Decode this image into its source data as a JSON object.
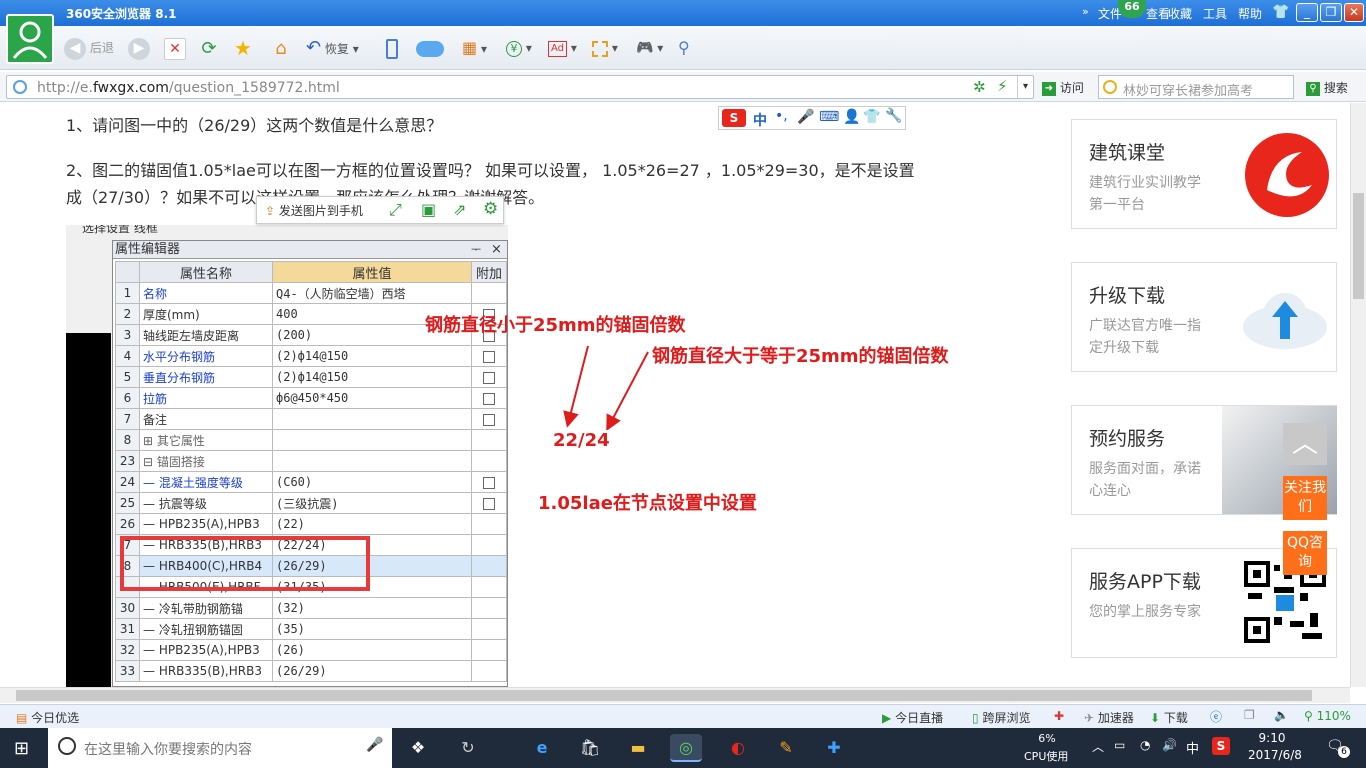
{
  "browser": {
    "title": "360安全浏览器 8.1",
    "menu": [
      "文件",
      "查看",
      "收藏",
      "工具",
      "帮助"
    ],
    "badge": "66",
    "toolbar": {
      "back_label": "后退",
      "restore_label": "恢复"
    },
    "address": {
      "url_prefix": "http://e.",
      "url_domain": "fwxgx.com",
      "url_path": "/question_1589772.html",
      "go_label": "访问"
    },
    "search": {
      "placeholder": "林妙可穿长裙参加高考",
      "button_label": "搜索"
    }
  },
  "question": {
    "line1": "1、请问图一中的（26/29）这两个数值是什么意思？",
    "line2a": "2、图二的锚固值1.05*lae可以在图一方框的位置设置吗？ 如果可以设置， 1.05*26=27 ，1.05*29=30，是不是设置",
    "line2b": "成（27/30）？如果不可以这样设置，那应该怎么处理？谢谢解答。"
  },
  "image_toolbar": {
    "send_label": "发送图片到手机"
  },
  "screenshot": {
    "top_strip": "选择设置   线框",
    "panel_title": "属性编辑器",
    "panel_pin": "ᅮ",
    "panel_close": "×",
    "headers": [
      "",
      "属性名称",
      "属性值",
      "附加"
    ],
    "rows": [
      {
        "n": "1",
        "name": "名称",
        "value": "Q4-（人防临空墙）西塔",
        "blue": true,
        "check": false
      },
      {
        "n": "2",
        "name": "厚度(mm)",
        "value": "400",
        "blue": false,
        "check": true
      },
      {
        "n": "3",
        "name": "轴线距左墙皮距离",
        "value": "(200)",
        "blue": false,
        "check": true
      },
      {
        "n": "4",
        "name": "水平分布钢筋",
        "value": "(2)ф14@150",
        "blue": true,
        "check": true
      },
      {
        "n": "5",
        "name": "垂直分布钢筋",
        "value": "(2)ф14@150",
        "blue": true,
        "check": true
      },
      {
        "n": "6",
        "name": "拉筋",
        "value": "ф6@450*450",
        "blue": true,
        "check": true
      },
      {
        "n": "7",
        "name": "备注",
        "value": "",
        "blue": false,
        "check": true
      },
      {
        "n": "8",
        "name": "⊞ 其它属性",
        "value": "",
        "blue": false,
        "check": false,
        "gray": true
      },
      {
        "n": "23",
        "name": "⊟ 锚固搭接",
        "value": "",
        "blue": false,
        "check": false,
        "gray": true
      },
      {
        "n": "24",
        "name": "— 混凝土强度等级",
        "value": "(C60)",
        "blue": true,
        "check": true
      },
      {
        "n": "25",
        "name": "— 抗震等级",
        "value": "(三级抗震)",
        "blue": false,
        "check": true
      },
      {
        "n": "26",
        "name": "— HPB235(A),HPB3",
        "value": "(22)",
        "blue": false,
        "check": false
      },
      {
        "n": "7",
        "name": "— HRB335(B),HRB3",
        "value": "(22/24)",
        "blue": false,
        "check": false
      },
      {
        "n": "8",
        "name": "— HRB400(C),HRB4",
        "value": "(26/29)",
        "blue": false,
        "check": false,
        "selected": true
      },
      {
        "n": "",
        "name": "— HRB500(E),HRBF",
        "value": "(31/35)",
        "blue": false,
        "check": false
      },
      {
        "n": "30",
        "name": "— 冷轧带肋钢筋锚",
        "value": "(32)",
        "blue": false,
        "check": false
      },
      {
        "n": "31",
        "name": "— 冷轧扭钢筋锚固",
        "value": "(35)",
        "blue": false,
        "check": false
      },
      {
        "n": "32",
        "name": "— HPB235(A),HPB3",
        "value": "(26)",
        "blue": false,
        "check": false
      },
      {
        "n": "33",
        "name": "— HRB335(B),HRB3",
        "value": "(26/29)",
        "blue": false,
        "check": false
      }
    ]
  },
  "annotations": {
    "a1": "钢筋直径小于25mm的锚固倍数",
    "a2": "钢筋直径大于等于25mm的锚固倍数",
    "a3": "22/24",
    "a4": "1.05lae在节点设置中设置"
  },
  "sidebar": {
    "cards": [
      {
        "title": "建筑课堂",
        "sub": "建筑行业实训教学第一平台"
      },
      {
        "title": "升级下载",
        "sub": "广联达官方唯一指定升级下载"
      },
      {
        "title": "预约服务",
        "sub": "服务面对面，承诺心连心"
      },
      {
        "title": "服务APP下载",
        "sub": "您的掌上服务专家"
      }
    ],
    "follow": "关注我们",
    "qq": "QQ咨询"
  },
  "statusbar": {
    "left": "今日优选",
    "live": "今日直播",
    "fullscreen": "跨屏浏览",
    "speed": "加速器",
    "download": "下载",
    "zoom": "110%"
  },
  "taskbar": {
    "search_placeholder": "在这里输入你要搜索的内容",
    "cpu_pct": "6%",
    "cpu_label": "CPU使用",
    "ime": "中",
    "time": "9:10",
    "date": "2017/6/8",
    "notif": "6"
  },
  "colors": {
    "accent": "#1e6fd6",
    "annotation": "#e01b1b",
    "side_orange": "#ff6f1a",
    "link_blue": "#1a3fd4"
  }
}
